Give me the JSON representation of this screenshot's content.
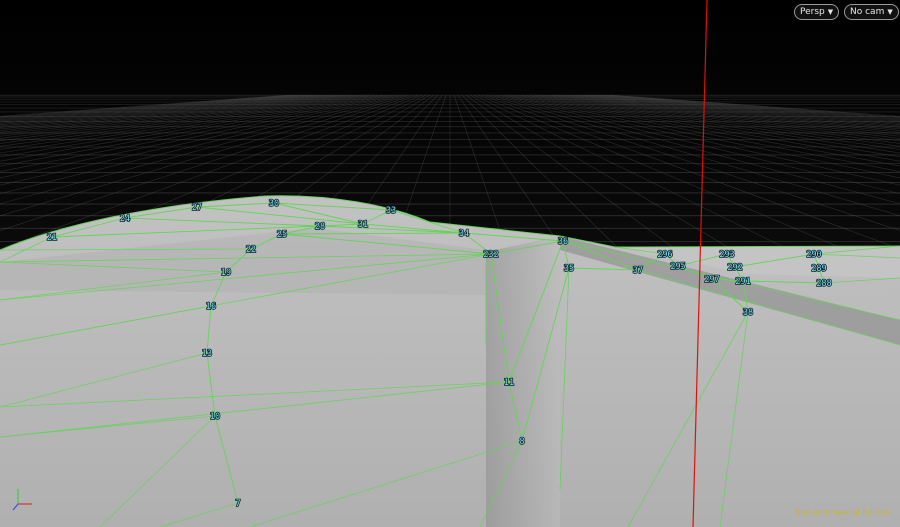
{
  "toolbar": {
    "view_label": "Persp",
    "camera_label": "No cam"
  },
  "status": {
    "message": "Non-commercial Edition"
  },
  "colors": {
    "background": "#000000",
    "grid": "#5a5a5a",
    "surface": "#b9b9b9",
    "wireframe": "#63d455",
    "point_labels": "#77e6ff",
    "y_axis": "#e01010",
    "status_text": "#c9b52a"
  },
  "point_labels": [
    "21",
    "24",
    "27",
    "30",
    "33",
    "25",
    "28",
    "31",
    "34",
    "22",
    "19",
    "16",
    "13",
    "10",
    "7",
    "36",
    "35",
    "37",
    "296",
    "295",
    "293",
    "292",
    "290",
    "289",
    "297",
    "291",
    "288",
    "38",
    "11",
    "8",
    "232"
  ],
  "icons": {
    "dropdown": "chevron-down-icon",
    "axis": "axis-gizmo-icon"
  }
}
